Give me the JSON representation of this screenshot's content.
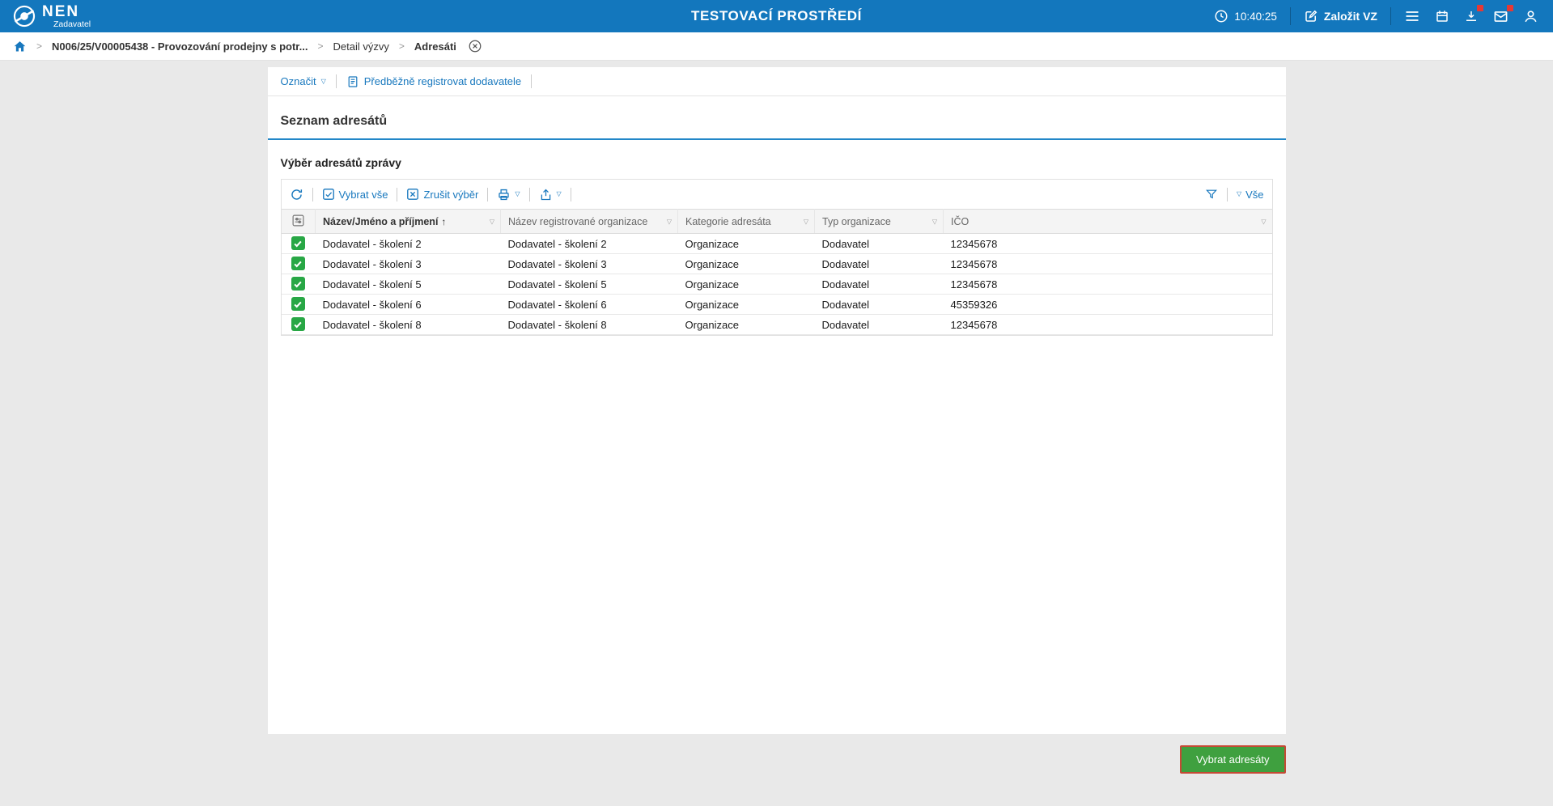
{
  "topbar": {
    "brand": "NEN",
    "brand_sub": "Zadavatel",
    "environment_title": "TESTOVACÍ PROSTŘEDÍ",
    "time": "10:40:25",
    "create_vz_label": "Založit VZ"
  },
  "breadcrumb": {
    "item_contract": "N006/25/V00005438 - Provozování prodejny s potr...",
    "item_detail": "Detail výzvy",
    "item_current": "Adresáti"
  },
  "actions": {
    "mark_label": "Označit",
    "preregister_label": "Předběžně registrovat dodavatele"
  },
  "section": {
    "title": "Seznam adresátů",
    "subtitle": "Výběr adresátů zprávy"
  },
  "grid": {
    "toolbar": {
      "select_all_label": "Vybrat vše",
      "clear_selection_label": "Zrušit výběr",
      "all_filter_label": "Vše"
    },
    "columns": [
      "Název/Jméno a příjmení",
      "Název registrované organizace",
      "Kategorie adresáta",
      "Typ organizace",
      "IČO"
    ],
    "rows": [
      {
        "name": "Dodavatel - školení 2",
        "org": "Dodavatel - školení 2",
        "category": "Organizace",
        "type": "Dodavatel",
        "ico": "12345678"
      },
      {
        "name": "Dodavatel - školení 3",
        "org": "Dodavatel - školení 3",
        "category": "Organizace",
        "type": "Dodavatel",
        "ico": "12345678"
      },
      {
        "name": "Dodavatel - školení 5",
        "org": "Dodavatel - školení 5",
        "category": "Organizace",
        "type": "Dodavatel",
        "ico": "12345678"
      },
      {
        "name": "Dodavatel - školení 6",
        "org": "Dodavatel - školení 6",
        "category": "Organizace",
        "type": "Dodavatel",
        "ico": "45359326"
      },
      {
        "name": "Dodavatel - školení 8",
        "org": "Dodavatel - školení 8",
        "category": "Organizace",
        "type": "Dodavatel",
        "ico": "12345678"
      }
    ]
  },
  "footer": {
    "select_recipients_label": "Vybrat adresáty"
  },
  "icons": {
    "dropdown": "▽",
    "sort_ascending": "↑",
    "breadcrumb_separator": ">"
  },
  "colors": {
    "topbar_blue": "#1377bd",
    "accent_blue": "#1878be",
    "section_underline_blue": "#2287c8",
    "checkbox_green": "#28a745",
    "button_green": "#3fa03f",
    "button_border_red": "#c44a35",
    "badge_red": "#e53935"
  }
}
